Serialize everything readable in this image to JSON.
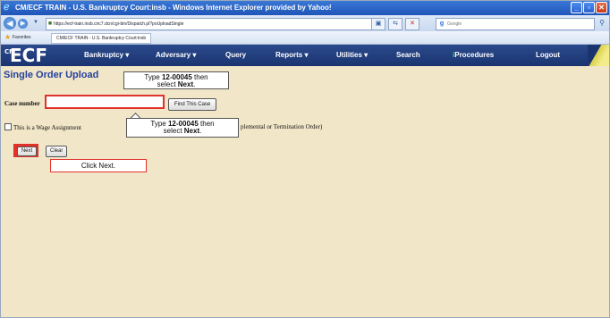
{
  "window": {
    "title": "CM/ECF TRAIN - U.S. Bankruptcy Court:insb - Windows Internet Explorer provided by Yahoo!",
    "buttons": [
      "minimize",
      "maximize",
      "close"
    ]
  },
  "browser": {
    "address": "https://ecf-train.insb.circ7.dcn/cgi-bin/Dispatch.pl?poUploadSingle",
    "search_placeholder": "Google",
    "favorites_label": "Favorites",
    "tab_title": "CM/ECF TRAIN - U.S. Bankruptcy Court:insb"
  },
  "ecf": {
    "logo_small": "CM",
    "logo": "ECF",
    "menu": [
      {
        "label": "Bankruptcy"
      },
      {
        "label": "Adversary"
      },
      {
        "label": "Query"
      },
      {
        "label": "Reports"
      },
      {
        "label": "Utilities"
      },
      {
        "label": "Search"
      },
      {
        "label": "Procedures"
      },
      {
        "label": "Logout"
      }
    ]
  },
  "page": {
    "title": "Single Order Upload",
    "case_label": "Case number",
    "case_value": "",
    "find_button": "Find This Case",
    "wage_text_start": "This is a Wage Assignment",
    "wage_text_end": "plemental or Termination Order)",
    "wage_checked": false,
    "next_button": "Next",
    "clear_button": "Clear"
  },
  "callouts": {
    "top_line1_a": "Type ",
    "top_line1_b": "12-00045",
    "top_line1_c": " then",
    "top_line2_a": "select ",
    "top_line2_b": "Next",
    "top_line2_c": ".",
    "mid_line1_a": "Type ",
    "mid_line1_b": "12-00045",
    "mid_line1_c": " then",
    "mid_line2_a": "select ",
    "mid_line2_b": "Next",
    "mid_line2_c": ".",
    "bottom": "Click Next."
  },
  "icons": {
    "ie": "internet-explorer-icon",
    "back": "back-arrow-icon",
    "forward": "forward-arrow-icon",
    "lock": "lock-icon",
    "star": "favorites-star-icon"
  }
}
